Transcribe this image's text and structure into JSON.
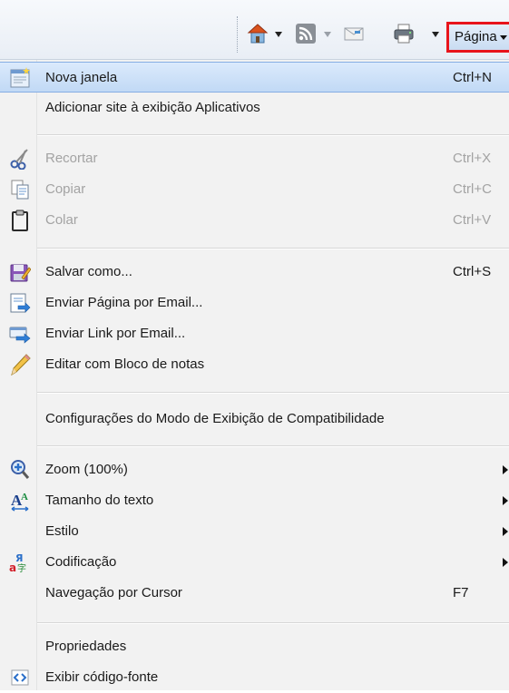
{
  "toolbar": {
    "home_icon": "home-icon",
    "feeds_icon": "rss-feed-icon",
    "mail_icon": "read-mail-icon",
    "print_icon": "printer-icon",
    "page_label": "Página",
    "highlight_color": "#e8141b"
  },
  "menu": {
    "items": [
      {
        "label": "Nova janela",
        "shortcut": "Ctrl+N",
        "icon": "new-window-icon"
      },
      {
        "label": "Adicionar site à exibição Aplicativos"
      },
      {
        "label": "Recortar",
        "shortcut": "Ctrl+X",
        "icon": "scissors-icon",
        "disabled": true
      },
      {
        "label": "Copiar",
        "shortcut": "Ctrl+C",
        "icon": "copy-icon",
        "disabled": true
      },
      {
        "label": "Colar",
        "shortcut": "Ctrl+V",
        "icon": "clipboard-icon",
        "disabled": true
      },
      {
        "label": "Salvar como...",
        "shortcut": "Ctrl+S",
        "icon": "save-as-icon"
      },
      {
        "label": "Enviar Página por Email...",
        "icon": "send-page-icon"
      },
      {
        "label": "Enviar Link por Email...",
        "icon": "send-link-icon"
      },
      {
        "label": "Editar com Bloco de notas",
        "icon": "pencil-icon"
      },
      {
        "label": "Configurações do Modo de Exibição de Compatibilidade"
      },
      {
        "label": "Zoom (100%)",
        "icon": "zoom-icon",
        "submenu": true
      },
      {
        "label": "Tamanho do texto",
        "icon": "text-size-icon",
        "submenu": true
      },
      {
        "label": "Estilo",
        "submenu": true
      },
      {
        "label": "Codificação",
        "icon": "encoding-icon",
        "submenu": true
      },
      {
        "label": "Navegação por Cursor",
        "shortcut": "F7"
      },
      {
        "label": "Propriedades"
      },
      {
        "label": "Exibir código-fonte",
        "icon": "view-source-icon"
      }
    ]
  }
}
